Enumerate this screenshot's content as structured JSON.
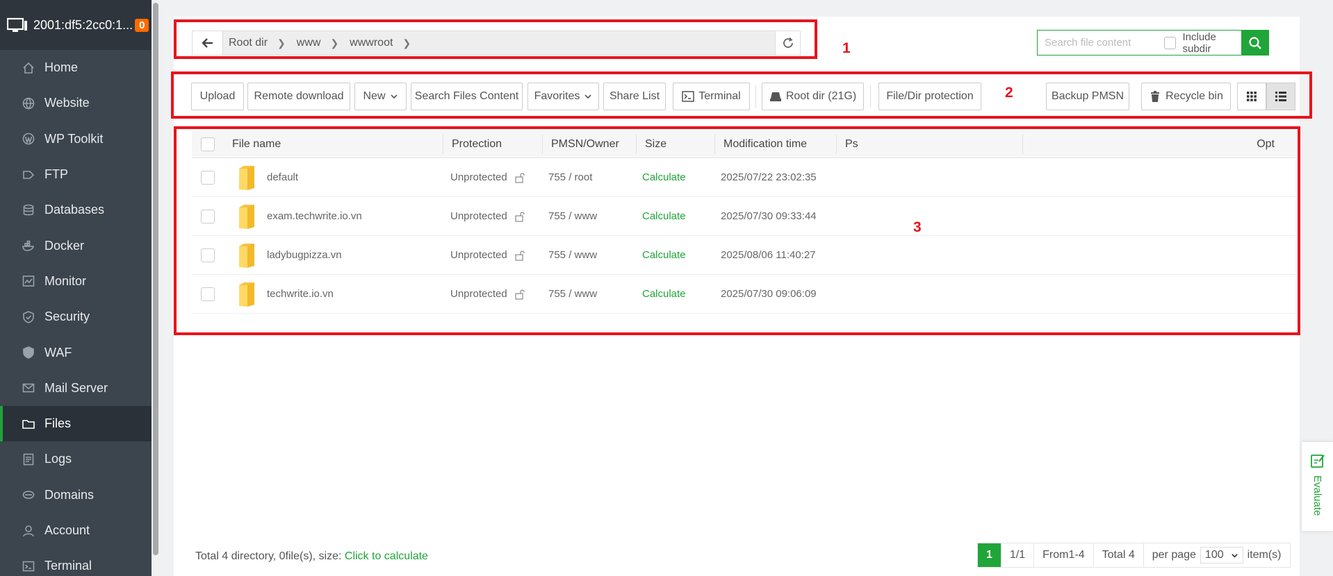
{
  "sidebar": {
    "server": "2001:df5:2cc0:1...",
    "badge": "0",
    "items": [
      {
        "label": "Home",
        "icon": "home-icon"
      },
      {
        "label": "Website",
        "icon": "globe-icon"
      },
      {
        "label": "WP Toolkit",
        "icon": "wordpress-icon"
      },
      {
        "label": "FTP",
        "icon": "ftp-icon"
      },
      {
        "label": "Databases",
        "icon": "database-icon"
      },
      {
        "label": "Docker",
        "icon": "docker-icon"
      },
      {
        "label": "Monitor",
        "icon": "monitor-icon"
      },
      {
        "label": "Security",
        "icon": "shield-icon"
      },
      {
        "label": "WAF",
        "icon": "waf-shield-icon"
      },
      {
        "label": "Mail Server",
        "icon": "mail-icon"
      },
      {
        "label": "Files",
        "icon": "folder-icon"
      },
      {
        "label": "Logs",
        "icon": "logs-icon"
      },
      {
        "label": "Domains",
        "icon": "domains-icon"
      },
      {
        "label": "Account",
        "icon": "user-icon"
      },
      {
        "label": "Terminal",
        "icon": "terminal-icon"
      }
    ],
    "active": "Files"
  },
  "breadcrumb": [
    "Root dir",
    "www",
    "wwwroot"
  ],
  "search": {
    "placeholder": "Search file content",
    "include_subdir": "Include subdir"
  },
  "annotations": [
    "1",
    "2",
    "3"
  ],
  "toolbar": {
    "upload": "Upload",
    "remote_download": "Remote download",
    "new": "New",
    "search_files_content": "Search Files Content",
    "favorites": "Favorites",
    "share_list": "Share List",
    "terminal": "Terminal",
    "root_dir": "Root dir (21G)",
    "file_dir_protection": "File/Dir protection",
    "backup_pmsn": "Backup PMSN",
    "recycle_bin": "Recycle bin"
  },
  "table": {
    "headers": {
      "name": "File name",
      "protection": "Protection",
      "pmsn": "PMSN/Owner",
      "size": "Size",
      "mtime": "Modification time",
      "ps": "Ps",
      "opt": "Opt"
    },
    "rows": [
      {
        "name": "default",
        "protection": "Unprotected",
        "pmsn": "755 / root",
        "size": "Calculate",
        "mtime": "2025/07/22 23:02:35"
      },
      {
        "name": "exam.techwrite.io.vn",
        "protection": "Unprotected",
        "pmsn": "755 / www",
        "size": "Calculate",
        "mtime": "2025/07/30 09:33:44"
      },
      {
        "name": "ladybugpizza.vn",
        "protection": "Unprotected",
        "pmsn": "755 / www",
        "size": "Calculate",
        "mtime": "2025/08/06 11:40:27"
      },
      {
        "name": "techwrite.io.vn",
        "protection": "Unprotected",
        "pmsn": "755 / www",
        "size": "Calculate",
        "mtime": "2025/07/30 09:06:09"
      }
    ]
  },
  "footer": {
    "summary": "Total 4 directory, 0file(s), size:",
    "calc_link": "Click to calculate"
  },
  "pager": {
    "current": "1",
    "pages": "1/1",
    "range": "From1-4",
    "total": "Total 4",
    "per_page": "per page",
    "per_page_value": "100",
    "items": "item(s)"
  },
  "evaluate": "Evaluate",
  "colors": {
    "accent": "#20a53a",
    "annotation": "#e8141c",
    "sidebar": "#3c444d"
  }
}
